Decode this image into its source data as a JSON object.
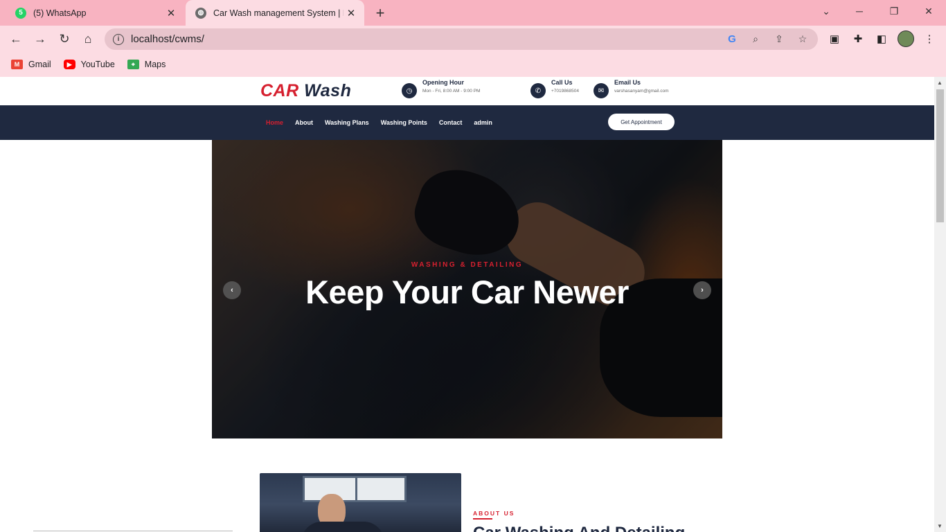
{
  "browser": {
    "tabs": [
      {
        "title": "(5) WhatsApp",
        "badge": "5",
        "active": false
      },
      {
        "title": "Car Wash management System | Ho",
        "active": true
      }
    ],
    "url": "localhost/cwms/",
    "bookmarks": [
      {
        "label": "Gmail",
        "icon": "gmail-icon"
      },
      {
        "label": "YouTube",
        "icon": "youtube-icon"
      },
      {
        "label": "Maps",
        "icon": "maps-icon"
      }
    ]
  },
  "site": {
    "logo": {
      "car": "CAR",
      "wash": "Wash"
    },
    "info": [
      {
        "title": "Opening Hour",
        "sub": "Mon - Fri, 8:00 AM - 9:00 PM",
        "icon": "clock-icon"
      },
      {
        "title": "Call Us",
        "sub": "+7019868504",
        "icon": "phone-icon"
      },
      {
        "title": "Email Us",
        "sub": "varshasanyam@gmail.com",
        "icon": "envelope-icon"
      }
    ],
    "nav": [
      {
        "label": "Home",
        "active": true
      },
      {
        "label": "About"
      },
      {
        "label": "Washing Plans"
      },
      {
        "label": "Washing Points"
      },
      {
        "label": "Contact"
      },
      {
        "label": "admin"
      }
    ],
    "cta": "Get Appointment",
    "hero": {
      "subtitle": "WASHING & DETAILING",
      "title": "Keep Your Car Newer",
      "prev": "‹",
      "next": "›"
    },
    "about": {
      "label": "ABOUT US",
      "title": "Car Washing And Detailing"
    }
  },
  "colors": {
    "brand_red": "#d6202f",
    "brand_navy": "#1f2940",
    "tab_strip": "#f8b3c1",
    "toolbar": "#fcdce3"
  }
}
